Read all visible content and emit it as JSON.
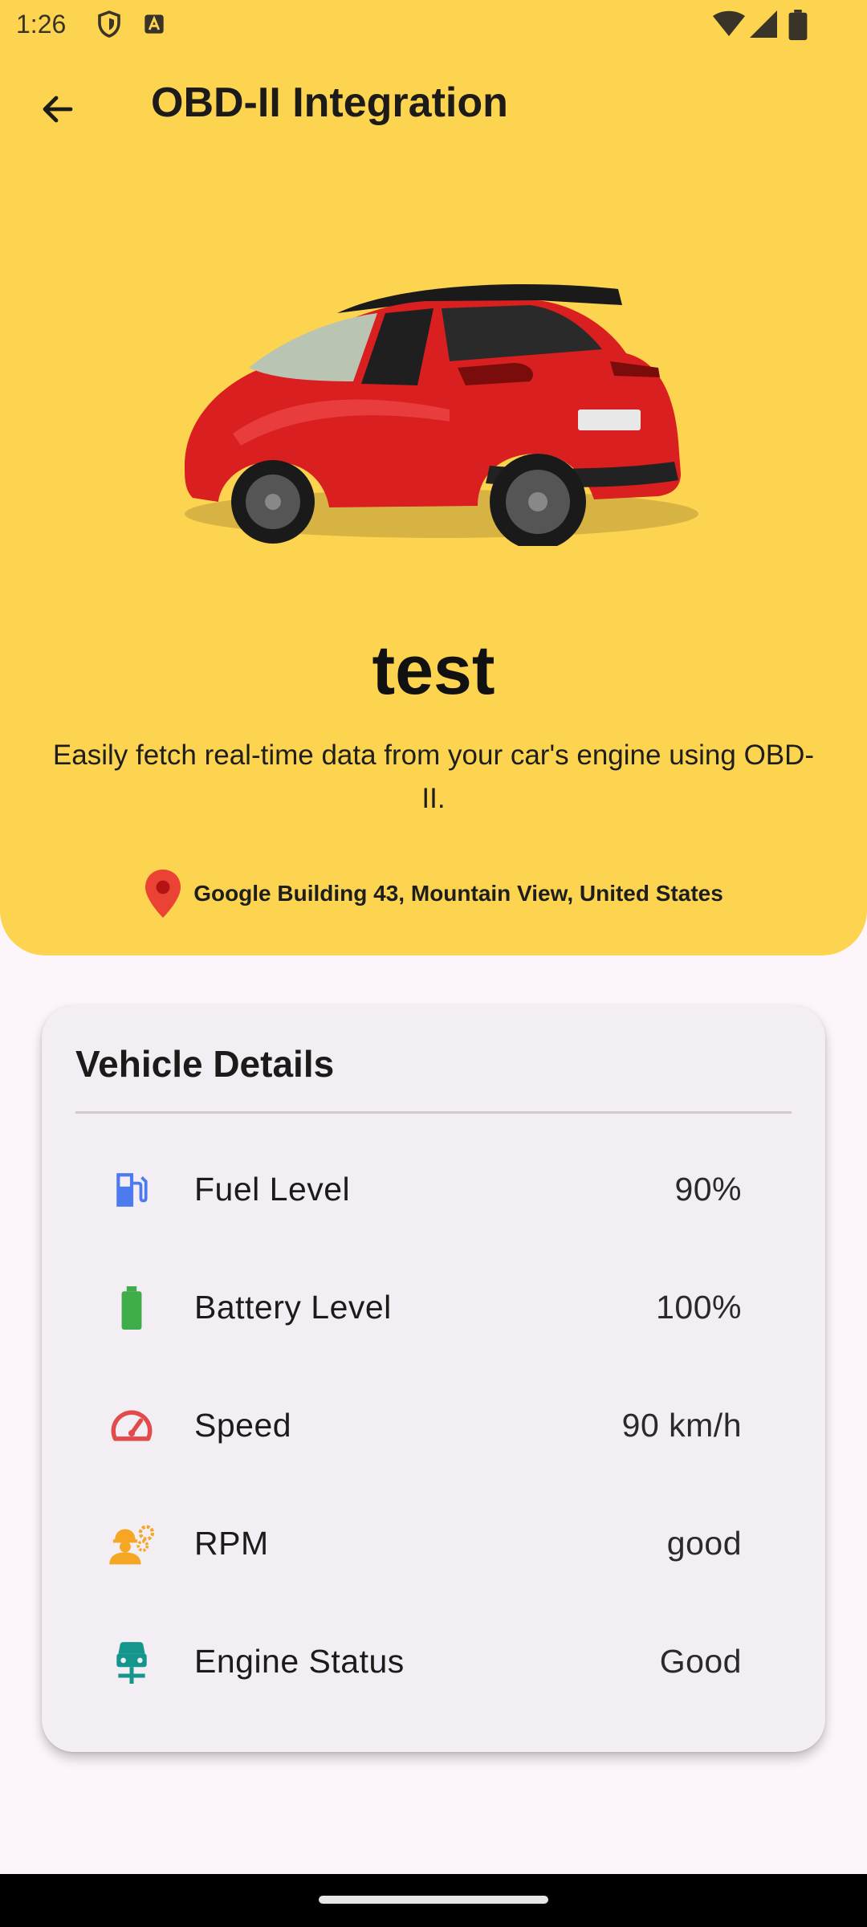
{
  "status_bar": {
    "time": "1:26"
  },
  "app_bar": {
    "title": "OBD-II Integration"
  },
  "vehicle": {
    "name": "test",
    "description": "Easily fetch real-time data from your car's engine using OBD-II.",
    "location": "Google Building 43, Mountain View, United States"
  },
  "colors": {
    "header_bg": "#FDD44F",
    "fuel_icon": "#4C7BF0",
    "battery_icon": "#3FAE4A",
    "speed_icon": "#E24B4B",
    "rpm_icon": "#F5A623",
    "engine_icon": "#14968C",
    "location_pin": "#EA4335"
  },
  "details_card": {
    "title": "Vehicle Details",
    "rows": [
      {
        "icon": "fuel-pump-icon",
        "label": "Fuel Level",
        "value": "90%"
      },
      {
        "icon": "battery-icon",
        "label": "Battery Level",
        "value": "100%"
      },
      {
        "icon": "speedometer-icon",
        "label": "Speed",
        "value": "90 km/h"
      },
      {
        "icon": "engineer-icon",
        "label": "RPM",
        "value": "good"
      },
      {
        "icon": "car-service-icon",
        "label": "Engine Status",
        "value": "Good"
      }
    ]
  }
}
